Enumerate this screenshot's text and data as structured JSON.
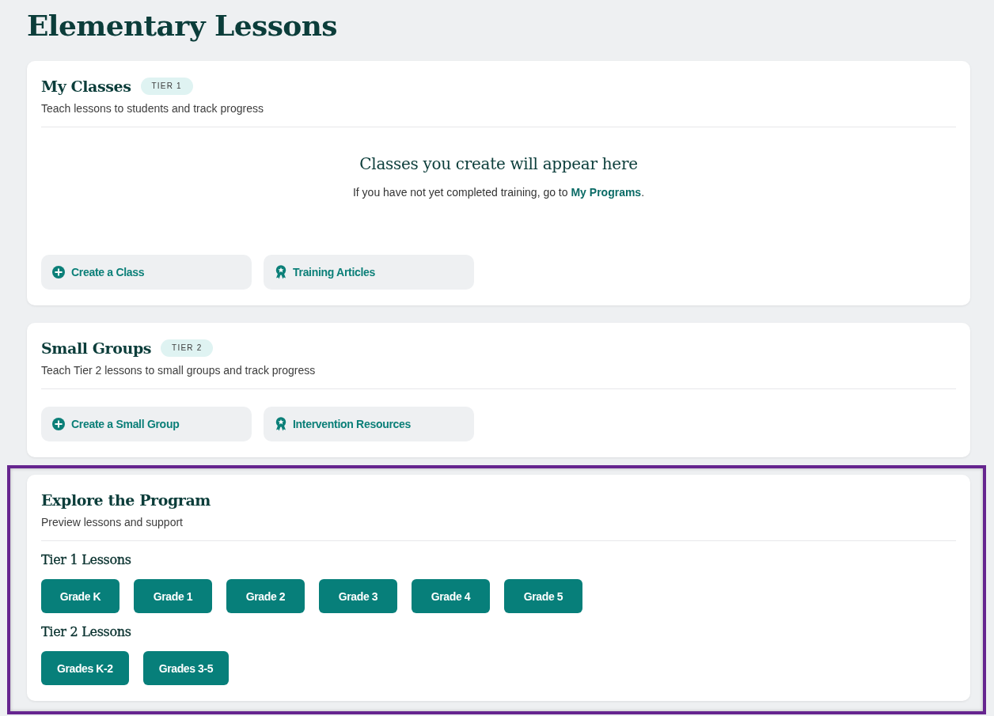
{
  "page_title": "Elementary Lessons",
  "sections": [
    {
      "title": "My Classes",
      "badge": "TIER 1",
      "subtitle": "Teach lessons to students and track progress",
      "empty_state": {
        "heading": "Classes you create will appear here",
        "text": "If you have not yet completed training, go to ",
        "link": "My Programs",
        "text_end": "."
      },
      "actions": [
        {
          "label": "Create a Class",
          "kind": "create"
        },
        {
          "label": "Training Articles",
          "kind": "resource"
        }
      ]
    },
    {
      "title": "Small Groups",
      "badge": "TIER 2",
      "subtitle": "Teach Tier 2 lessons to small groups and track progress",
      "actions": [
        {
          "label": "Create a Small Group",
          "kind": "create"
        },
        {
          "label": "Intervention Resources",
          "kind": "resource"
        }
      ]
    },
    {
      "title": "Explore the Program",
      "subtitle": "Preview lessons and support",
      "highlighted": true,
      "lesson_groups": [
        {
          "title": "Tier 1 Lessons",
          "grades": [
            "Grade K",
            "Grade 1",
            "Grade 2",
            "Grade 3",
            "Grade 4",
            "Grade 5"
          ]
        },
        {
          "title": "Tier 2 Lessons",
          "grades": [
            "Grades K-2",
            "Grades 3-5"
          ]
        }
      ]
    }
  ]
}
